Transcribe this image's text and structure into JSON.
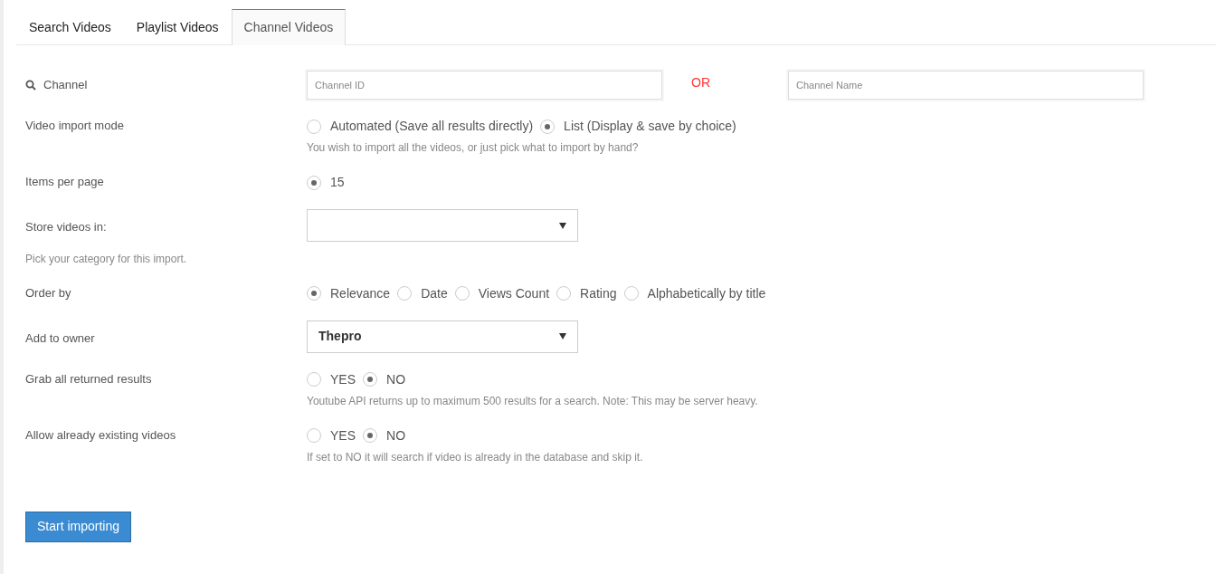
{
  "tabs": [
    {
      "label": "Search Videos",
      "selected": false
    },
    {
      "label": "Playlist Videos",
      "selected": false
    },
    {
      "label": "Channel Videos",
      "selected": true
    }
  ],
  "rows": [
    {
      "kind": "channel",
      "label": "Channel",
      "fields": [
        {
          "placeholder": "Channel ID"
        },
        {
          "placeholder": "Channel Name"
        }
      ],
      "separator": "OR"
    },
    {
      "kind": "radios",
      "label": "Video import mode",
      "options": [
        {
          "label": "Automated (Save all results directly)",
          "selected": false
        },
        {
          "label": "List (Display & save by choice)",
          "selected": true
        }
      ],
      "help": "You wish to import all the videos, or just pick what to import by hand?"
    },
    {
      "kind": "radios",
      "label": "Items per page",
      "options": [
        {
          "label": "15",
          "selected": true
        }
      ]
    },
    {
      "kind": "select",
      "label": "Store videos in:",
      "label_help": "Pick your category for this import."
    },
    {
      "kind": "radios",
      "label": "Order by",
      "options": [
        {
          "label": "Relevance",
          "selected": true
        },
        {
          "label": "Date",
          "selected": false
        },
        {
          "label": "Views Count",
          "selected": false
        },
        {
          "label": "Rating",
          "selected": false
        },
        {
          "label": "Alphabetically by title",
          "selected": false
        }
      ]
    },
    {
      "kind": "select",
      "label": "Add to owner",
      "value": "Thepro"
    },
    {
      "kind": "radios",
      "label": "Grab all returned results",
      "options": [
        {
          "label": "YES",
          "selected": false
        },
        {
          "label": "NO",
          "selected": true
        }
      ],
      "help": "Youtube API returns up to maximum 500 results for a search. Note: This may be server heavy."
    },
    {
      "kind": "radios",
      "label": "Allow already existing videos",
      "options": [
        {
          "label": "YES",
          "selected": false
        },
        {
          "label": "NO",
          "selected": true
        }
      ],
      "help": "If set to NO it will search if video is already in the database and skip it."
    }
  ],
  "button": "Start importing"
}
